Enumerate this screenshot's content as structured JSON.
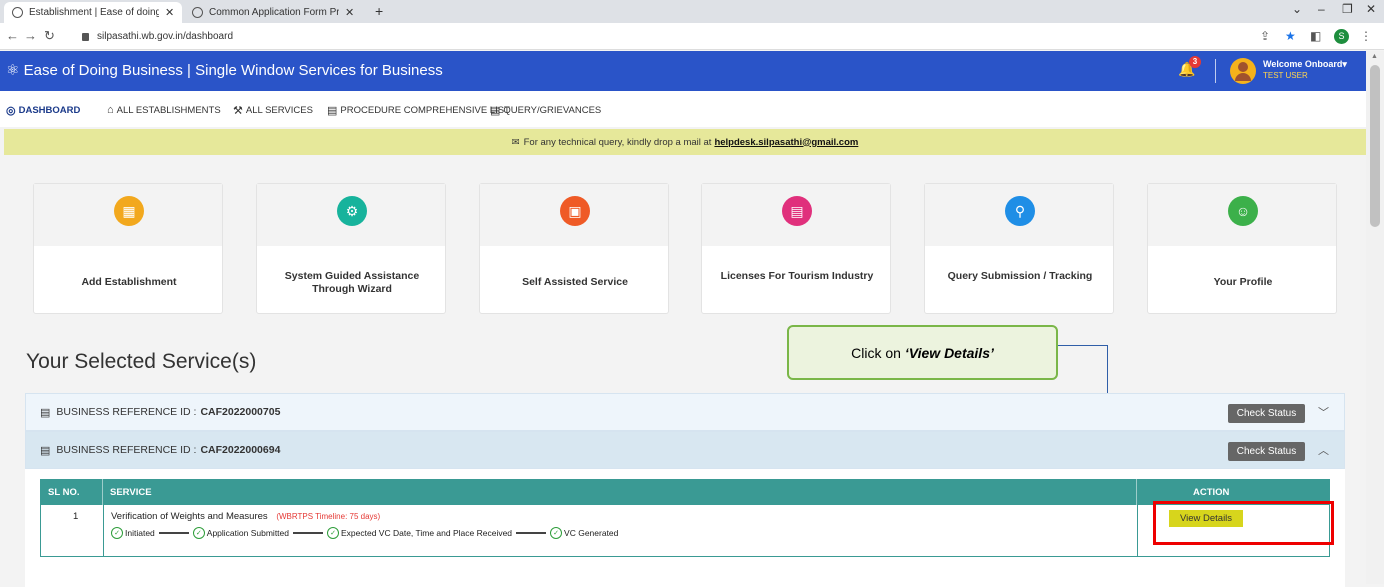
{
  "browser": {
    "tabs": [
      {
        "title": "Establishment | Ease of doing bu"
      },
      {
        "title": "Common Application Form Previ"
      }
    ],
    "url": "silpasathi.wb.gov.in/dashboard",
    "profile_letter": "S"
  },
  "header": {
    "title": "Ease of Doing Business | Single Window Services for Business",
    "notification_count": "3",
    "welcome": "Welcome Onboard",
    "user": "TEST USER",
    "accent_color": "#2a54c8"
  },
  "menu": {
    "items": [
      {
        "label": "DASHBOARD"
      },
      {
        "label": "ALL ESTABLISHMENTS"
      },
      {
        "label": "ALL SERVICES"
      },
      {
        "label": "PROCEDURE COMPREHENSIVE LIST"
      },
      {
        "label": "QUERY/GRIEVANCES"
      }
    ]
  },
  "notice": {
    "text": "For any technical query, kindly drop a mail at",
    "email": "helpdesk.silpasathi@gmail.com"
  },
  "cards": [
    {
      "label": "Add Establishment",
      "icon": "building-icon",
      "color": "#f2a81d"
    },
    {
      "label": "System Guided Assistance Through Wizard",
      "icon": "gear-icon",
      "color": "#17b39c"
    },
    {
      "label": "Self Assisted Service",
      "icon": "grid-icon",
      "color": "#ef5a26"
    },
    {
      "label": "Licenses For Tourism Industry",
      "icon": "document-icon",
      "color": "#e0307c"
    },
    {
      "label": "Query Submission / Tracking",
      "icon": "search-icon",
      "color": "#1f8ee6"
    },
    {
      "label": "Your Profile",
      "icon": "profile-icon",
      "color": "#3cb04a"
    }
  ],
  "section": {
    "title": "Your Selected Service(s)"
  },
  "callout": {
    "prefix": "Click on",
    "emphasis": "‘View Details’"
  },
  "business_refs": [
    {
      "label": "BUSINESS REFERENCE ID :",
      "id": "CAF2022000705",
      "button": "Check Status"
    },
    {
      "label": "BUSINESS REFERENCE ID :",
      "id": "CAF2022000694",
      "button": "Check Status"
    }
  ],
  "table": {
    "headers": {
      "sl": "SL NO.",
      "service": "SERVICE",
      "action": "ACTION"
    },
    "rows": [
      {
        "sl": "1",
        "service": "Verification of Weights and Measures",
        "timeline": "(WBRTPS Timeline: 75 days)",
        "steps": [
          "Initiated",
          "Application Submitted",
          "Expected VC Date, Time and Place Received",
          "VC Generated"
        ],
        "action": "View Details"
      }
    ]
  }
}
